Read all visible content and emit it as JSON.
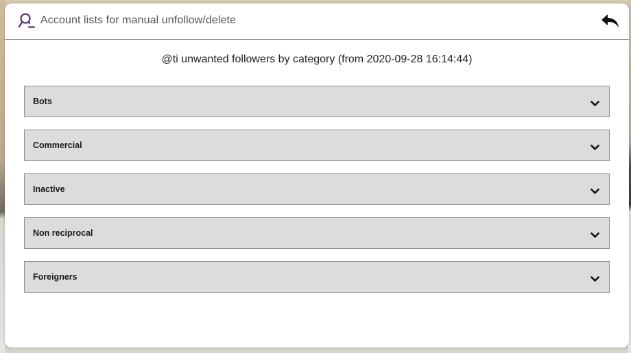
{
  "header": {
    "title": "Account lists for manual unfollow/delete",
    "icon": "user-remove-icon",
    "back_icon": "reply-arrow-icon"
  },
  "subtitle": "@ti unwanted followers by category (from 2020-09-28 16:14:44)",
  "categories": [
    {
      "label": "Bots"
    },
    {
      "label": "Commercial"
    },
    {
      "label": "Inactive"
    },
    {
      "label": "Non reciprocal"
    },
    {
      "label": "Foreigners"
    }
  ],
  "colors": {
    "accent": "#5b2c6f",
    "item_background": "#dcdcdc",
    "item_border": "#8f8f8f"
  }
}
